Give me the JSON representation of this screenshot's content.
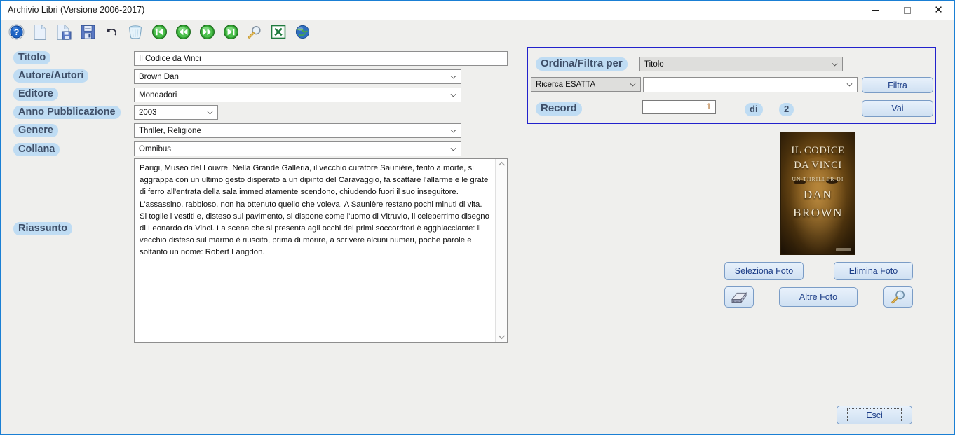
{
  "window": {
    "title": "Archivio Libri (Versione 2006-2017)",
    "controls": {
      "minimize": "–",
      "maximize": "□",
      "close": "✕"
    }
  },
  "toolbar": {
    "items": [
      {
        "name": "help-icon",
        "tooltip": "Aiuto"
      },
      {
        "name": "new-document-icon",
        "tooltip": "Nuovo"
      },
      {
        "name": "save-as-icon",
        "tooltip": "Salva con nome"
      },
      {
        "name": "save-icon",
        "tooltip": "Salva"
      },
      {
        "name": "undo-icon",
        "tooltip": "Annulla"
      },
      {
        "name": "delete-trash-icon",
        "tooltip": "Elimina"
      },
      {
        "name": "first-record-icon",
        "tooltip": "Primo"
      },
      {
        "name": "previous-record-icon",
        "tooltip": "Precedente"
      },
      {
        "name": "next-record-icon",
        "tooltip": "Successivo"
      },
      {
        "name": "last-record-icon",
        "tooltip": "Ultimo"
      },
      {
        "name": "search-magnifier-icon",
        "tooltip": "Cerca"
      },
      {
        "name": "excel-export-icon",
        "tooltip": "Esporta in Excel"
      },
      {
        "name": "web-globe-icon",
        "tooltip": "Web"
      }
    ]
  },
  "form": {
    "titolo": {
      "label": "Titolo",
      "value": "Il Codice da Vinci"
    },
    "autore": {
      "label": "Autore/Autori",
      "value": "Brown Dan"
    },
    "editore": {
      "label": "Editore",
      "value": "Mondadori"
    },
    "anno": {
      "label": "Anno Pubblicazione",
      "value": "2003"
    },
    "genere": {
      "label": "Genere",
      "value": "Thriller, Religione"
    },
    "collana": {
      "label": "Collana",
      "value": "Omnibus"
    },
    "riassunto": {
      "label": "Riassunto",
      "value": "Parigi, Museo del Louvre. Nella Grande Galleria, il vecchio curatore Saunière, ferito a morte, si aggrappa con un ultimo gesto disperato a un dipinto del Caravaggio, fa scattare l'allarme e le grate di ferro all'entrata della sala immediatamente scendono, chiudendo fuori il suo inseguitore. L'assassino, rabbioso, non ha ottenuto quello che voleva. A Saunière restano pochi minuti di vita. Si toglie i vestiti e, disteso sul pavimento, si dispone come l'uomo di Vitruvio, il celeberrimo disegno di Leonardo da Vinci. La scena che si presenta agli occhi dei primi soccorritori è agghiacciante: il vecchio disteso sul marmo è riuscito, prima di morire, a scrivere alcuni numeri, poche parole e soltanto un nome: Robert Langdon."
    }
  },
  "filter_panel": {
    "sort_label": "Ordina/Filtra per",
    "sort_value": "Titolo",
    "match_mode": "Ricerca ESATTA",
    "search_value": "",
    "filter_button": "Filtra",
    "record_label": "Record",
    "record_current": "1",
    "record_of": "di",
    "record_total": "2",
    "go_button": "Vai"
  },
  "cover": {
    "line1": "IL CODICE",
    "line2": "DA VINCI",
    "line3": "UN THRILLER DI",
    "line4": "DAN",
    "line5": "BROWN"
  },
  "photo_buttons": {
    "select": "Seleziona Foto",
    "delete": "Elimina Foto",
    "more": "Altre Foto",
    "scan_icon": "scanner-icon",
    "zoom_icon": "magnifier-icon"
  },
  "exit_button": {
    "label": "Esci"
  },
  "colors": {
    "window_border": "#1a7fd4",
    "background": "#efefed",
    "label_pill_bg": "#bfdcf3",
    "label_text": "#3d4d66",
    "panel_border": "#2222cc",
    "button_text": "#1c3d87",
    "record_number": "#a85c12"
  }
}
